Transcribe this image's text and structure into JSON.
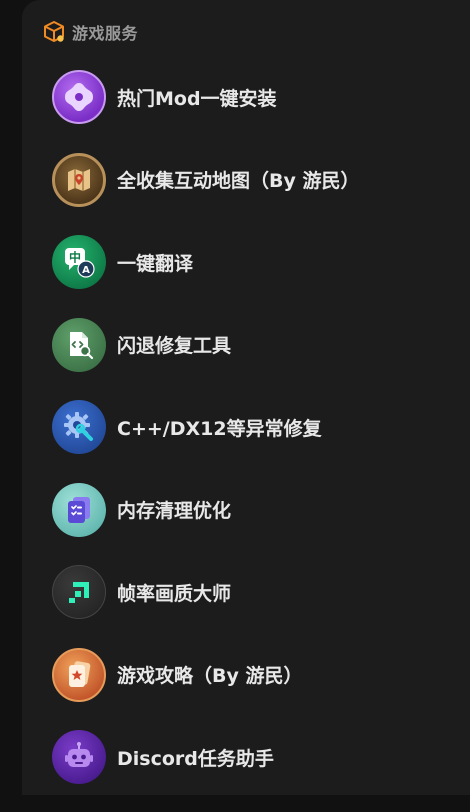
{
  "header": {
    "title": "游戏服务",
    "icon": "game-box-icon",
    "accent": "#f08a24"
  },
  "items": [
    {
      "label": "热门Mod一键安装",
      "icon": "mod-install-icon",
      "color": "#8e44d8"
    },
    {
      "label": "全收集互动地图（By 游民）",
      "icon": "map-icon",
      "color": "#8a6a3a"
    },
    {
      "label": "一键翻译",
      "icon": "translate-icon",
      "color": "#149a5a"
    },
    {
      "label": "闪退修复工具",
      "icon": "file-code-search-icon",
      "color": "#4e8a58"
    },
    {
      "label": "C++/DX12等异常修复",
      "icon": "gear-wrench-icon",
      "color": "#2f5db8"
    },
    {
      "label": "内存清理优化",
      "icon": "memory-checklist-icon",
      "color": "#7fcfc6"
    },
    {
      "label": "帧率画质大师",
      "icon": "fps-master-icon",
      "color": "#2e2e2e"
    },
    {
      "label": "游戏攻略（By 游民）",
      "icon": "guide-cards-icon",
      "color": "#d9703a"
    },
    {
      "label": "Discord任务助手",
      "icon": "discord-robot-icon",
      "color": "#5f2aa8"
    }
  ]
}
